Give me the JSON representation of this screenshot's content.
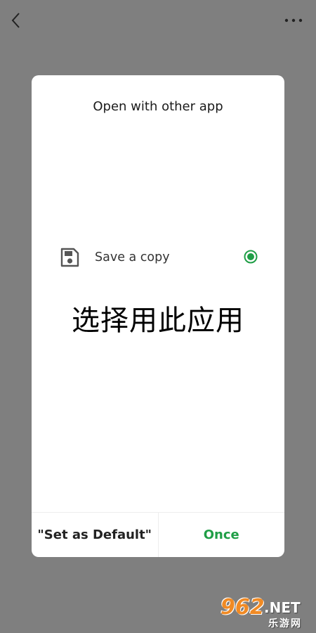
{
  "topbar": {
    "back_icon": "chevron-left-icon",
    "more_icon": "more-horizontal-icon"
  },
  "dialog": {
    "title": "Open with other app",
    "option": {
      "label": "Save a copy",
      "icon": "save-disk-icon",
      "selected": true
    },
    "overlay_text": "选择用此应用",
    "buttons": {
      "default_label": "\"Set as Default\"",
      "once_label": "Once"
    }
  },
  "watermark": {
    "main": "962",
    "suffix": ".NET",
    "sub": "乐游网"
  },
  "colors": {
    "backdrop": "#7f7f7f",
    "accent": "#1f9e46",
    "watermark": "#f08a24"
  }
}
